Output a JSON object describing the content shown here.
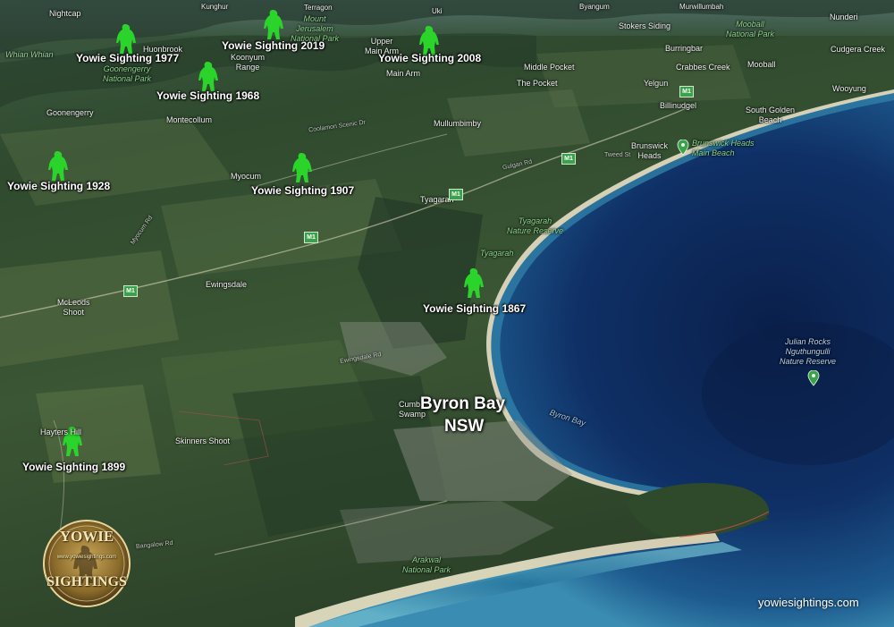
{
  "map": {
    "city_name": "Byron Bay",
    "city_state": "NSW",
    "watermark": "yowiesightings.com",
    "badge": {
      "top": "YOWIE",
      "url": "www.yowiesightings.com",
      "bottom": "SIGHTINGS"
    }
  },
  "sightings": [
    {
      "year": "1977",
      "label": "Yowie Sighting 1977"
    },
    {
      "year": "2019",
      "label": "Yowie Sighting 2019"
    },
    {
      "year": "2008",
      "label": "Yowie Sighting 2008"
    },
    {
      "year": "1968",
      "label": "Yowie Sighting 1968"
    },
    {
      "year": "1928",
      "label": "Yowie Sighting 1928"
    },
    {
      "year": "1907",
      "label": "Yowie Sighting 1907"
    },
    {
      "year": "1867",
      "label": "Yowie Sighting 1867"
    },
    {
      "year": "1899",
      "label": "Yowie Sighting 1899"
    }
  ],
  "places": {
    "nightcap": "Nightcap",
    "kunghur": "Kunghur",
    "terragon": "Terragon",
    "uki": "Uki",
    "byangum": "Byangum",
    "murwillumbah": "Murwillumbah",
    "nunderi": "Nunderi",
    "stokers_siding": "Stokers Siding",
    "burringbar": "Burringbar",
    "cudgera_creek": "Cudgera Creek",
    "huonbrook": "Huonbrook",
    "koonyum_range": "Koonyum\nRange",
    "upper_main_arm": "Upper\nMain Arm",
    "main_arm": "Main Arm",
    "middle_pocket": "Middle Pocket",
    "crabbes_creek": "Crabbes Creek",
    "mooball": "Mooball",
    "the_pocket": "The Pocket",
    "yelgun": "Yelgun",
    "billinudgel": "Billinudgel",
    "wooyung": "Wooyung",
    "goonengerry": "Goonengerry",
    "montecollum": "Montecollum",
    "mullumbimby": "Mullumbimby",
    "south_golden_beach": "South Golden\nBeach",
    "brunswick_heads": "Brunswick\nHeads",
    "myocum": "Myocum",
    "tyagarah": "Tyagarah",
    "tyagarah_beach": "Tyagarah",
    "ewingsdale": "Ewingsdale",
    "mcleods_shoot": "McLeods\nShoot",
    "skinners_shoot": "Skinners Shoot",
    "hayters_hill": "Hayters Hill",
    "cumbebin_swamp": "Cumb\nSwamp"
  },
  "parks": {
    "goonengerry_np": "Goonengerry\nNational Park",
    "mount_jerusalem_np": "Mount\nJerusalem\nNational Park",
    "mooball_np": "Mooball\nNational Park",
    "tyagarah_nr": "Tyagarah\nNature Reserve",
    "brunswick_beach": "Brunswick Heads\nMain Beach",
    "julian_rocks": "Julian Rocks\nNguthungulli\nNature Reserve",
    "arakwal_np": "Arakwal\nNational Park"
  },
  "water": {
    "whian_whian": "Whian Whian",
    "byron_bay_water": "Byron Bay"
  },
  "roads": {
    "m1_label": "M1",
    "coolamon": "Coolamon Scenic Dr",
    "gulgan": "Gulgan Rd",
    "tweed": "Tweed St",
    "myocum_rd": "Myocum Rd",
    "bangalow": "Bangalow Rd",
    "ewingsdale_rd": "Ewingsdale Rd"
  },
  "colors": {
    "yowie_green": "#2bd42b",
    "ocean_deep": "#0b2a5a",
    "ocean_shallow": "#2f7fa7",
    "sand": "#e9dcb8",
    "shield_green": "#3aa24a"
  },
  "icons": {
    "sighting_marker": "yowie-silhouette-icon",
    "route_shield": "m1-shield-icon",
    "park_pin": "green-pin-icon",
    "logo": "yowie-sightings-badge"
  }
}
